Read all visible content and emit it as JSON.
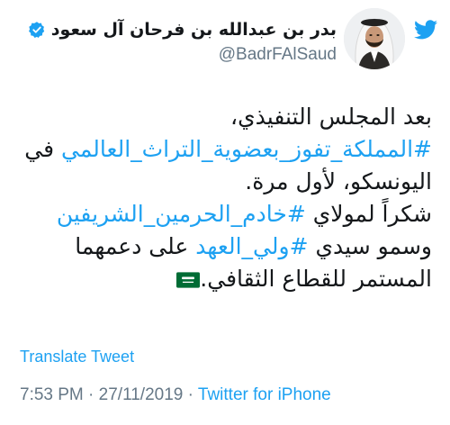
{
  "user": {
    "display_name": "بدر بن عبدالله بن فرحان آل سعود",
    "handle": "@BadrFAlSaud",
    "verified": true,
    "avatar_icon": "avatar-photo-icon"
  },
  "header": {
    "logo_icon": "twitter-bird-icon"
  },
  "tweet": {
    "lines": [
      {
        "segments": [
          {
            "text": "بعد المجلس التنفيذي،",
            "hashtag": false
          }
        ]
      },
      {
        "segments": [
          {
            "text": "#المملكة_تفوز_بعضوية_التراث_العالمي",
            "hashtag": true
          },
          {
            "text": " في",
            "hashtag": false
          }
        ]
      },
      {
        "segments": [
          {
            "text": "اليونسكو، لأول مرة.",
            "hashtag": false
          }
        ]
      },
      {
        "segments": [
          {
            "text": "شكراً لمولاي ",
            "hashtag": false
          },
          {
            "text": "#خادم_الحرمين_الشريفين",
            "hashtag": true
          }
        ]
      },
      {
        "segments": [
          {
            "text": "وسمو سيدي ",
            "hashtag": false
          },
          {
            "text": "#ولي_العهد",
            "hashtag": true
          },
          {
            "text": " على دعمهما",
            "hashtag": false
          }
        ]
      },
      {
        "segments": [
          {
            "text": "المستمر للقطاع الثقافي.",
            "hashtag": false
          }
        ],
        "emoji": "saudi-flag-icon"
      }
    ]
  },
  "actions": {
    "translate_label": "Translate Tweet"
  },
  "meta": {
    "time": "7:53 PM",
    "separator1": " · ",
    "date": "27/11/2019",
    "separator2": " · ",
    "source": "Twitter for iPhone"
  },
  "colors": {
    "link": "#1da1f2",
    "text": "#14171a",
    "muted": "#657786",
    "flag_green": "#006c35"
  }
}
